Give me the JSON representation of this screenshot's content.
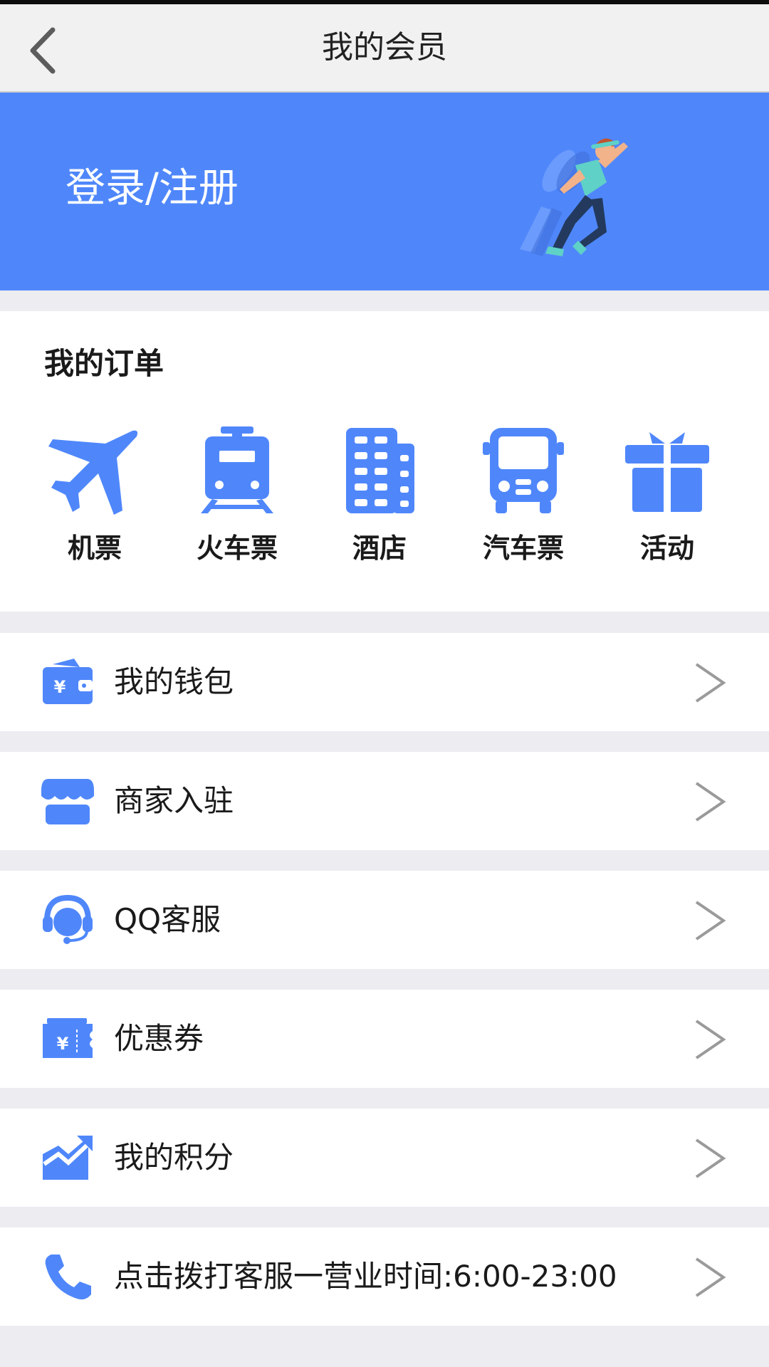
{
  "header": {
    "title": "我的会员",
    "back_icon": "chevron-left-icon"
  },
  "banner": {
    "login_label": "登录/注册",
    "color": "#4f87fb"
  },
  "orders": {
    "title": "我的订单",
    "items": [
      {
        "label": "机票",
        "icon": "airplane-icon"
      },
      {
        "label": "火车票",
        "icon": "train-icon"
      },
      {
        "label": "酒店",
        "icon": "hotel-icon"
      },
      {
        "label": "汽车票",
        "icon": "bus-icon"
      },
      {
        "label": "活动",
        "icon": "gift-icon"
      }
    ]
  },
  "menu": [
    {
      "label": "我的钱包",
      "icon": "wallet-icon"
    },
    {
      "label": "商家入驻",
      "icon": "store-icon"
    },
    {
      "label": "QQ客服",
      "icon": "headset-icon"
    },
    {
      "label": "优惠券",
      "icon": "coupon-icon"
    },
    {
      "label": "我的积分",
      "icon": "chart-up-icon"
    },
    {
      "label": "点击拨打客服一营业时间:6:00-23:00",
      "icon": "phone-icon"
    }
  ],
  "colors": {
    "accent": "#4f87fb",
    "text": "#1a1a1a",
    "background": "#ececf1"
  }
}
